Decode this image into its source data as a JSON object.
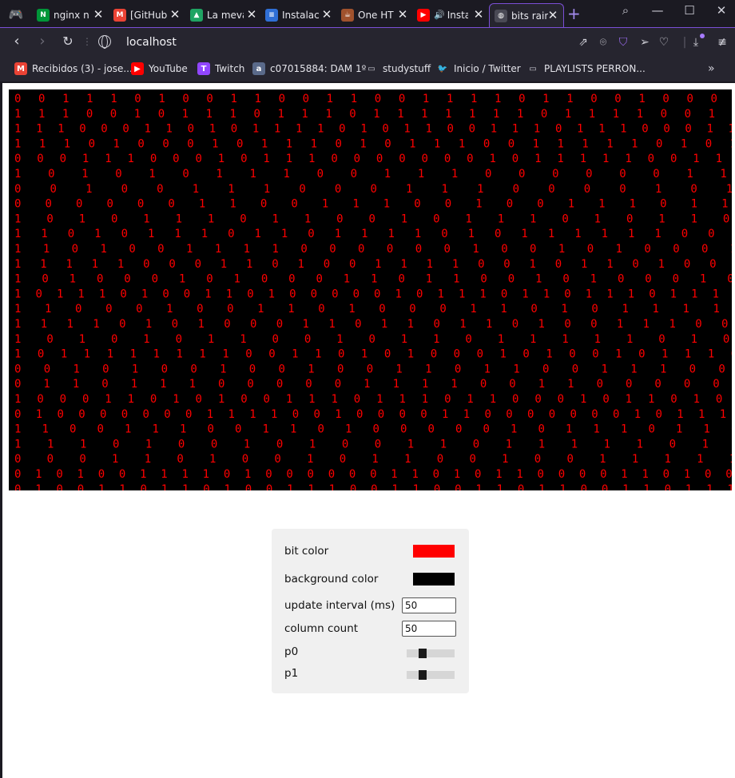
{
  "tabs": [
    {
      "title": "nginx n",
      "icon": "nginx-icon",
      "color": "#009639",
      "glyph": "N"
    },
    {
      "title": "[GitHub",
      "icon": "gmail-icon",
      "color": "#ea4335",
      "glyph": "M"
    },
    {
      "title": "La meva",
      "icon": "google-drive-icon",
      "color": "#1fa463",
      "glyph": "▲"
    },
    {
      "title": "Instalac",
      "icon": "contact-card-icon",
      "color": "#2f6fd6",
      "glyph": "≡"
    },
    {
      "title": "One HT",
      "icon": "coffee-icon",
      "color": "#a0522d",
      "glyph": "☕"
    },
    {
      "title": "Insta",
      "icon": "youtube-icon",
      "color": "#ff0000",
      "glyph": "▶"
    },
    {
      "title": "bits rain",
      "icon": "globe-icon",
      "color": "#4a4a55",
      "glyph": "◍"
    }
  ],
  "address": {
    "url": "localhost"
  },
  "bookmarks": [
    {
      "label": "Recibidos (3) - jose...",
      "icon": "gmail-icon",
      "color": "#ea4335",
      "glyph": "M"
    },
    {
      "label": "YouTube",
      "icon": "youtube-icon",
      "color": "#ff0000",
      "glyph": "▶"
    },
    {
      "label": "Twitch",
      "icon": "twitch-icon",
      "color": "#9146ff",
      "glyph": "T"
    },
    {
      "label": "c07015884: DAM 1º",
      "icon": "school-icon",
      "color": "#5a6a8a",
      "glyph": "a"
    },
    {
      "label": "studystuff",
      "icon": "folder-icon",
      "color": "transparent",
      "glyph": "▭"
    },
    {
      "label": "Inicio / Twitter",
      "icon": "twitter-icon",
      "color": "transparent",
      "glyph": "🐦"
    },
    {
      "label": "PLAYLISTS PERRON...",
      "icon": "folder-icon",
      "color": "transparent",
      "glyph": "▭"
    }
  ],
  "rain": {
    "bit_color": "#ff0000",
    "background_color": "#000000",
    "rows": [
      "  0 0      1 1      1 0      1 0      0 1 1   0 0 1 1 0    0    1 1 1 1    0    1 1 0    0      1    0    0 0 1",
      "  1 1    1      0 0 1 0      1 1 1    0      1      1      1 0 1 1 1    1 1 1 1 0    1    1    1    1 0 0 1",
      "1    1 1 0    0 0        1    1 0 1 0 1 1 1    1          0 1 0 1 1 0 0    1    1 1 0 1    1 1 0    0 0 1    1",
      "1    1      1 0 1    0 0 0 1    0 1    1 1 0 1 0      1 1 1          0 0 1    1 1 1          1        0    1 0 1 0",
      "  0 0 0    1 1    1 0 0 0    1    0 1    1              1          0 0 0 0 0 0 0 1    0 1 1 1    1 1 0 0 1 1",
      "  1 0    1        0 1        0 1          1        1 0    0        1    1 1 0        0    0 0 0        0 1        1 1 1",
      "    0 0        1 0    0 1    1    1      0 0          0    1 1 1 0    0 0        0        1        0            1        0 1 1",
      "0    0 0 0 0 0 1 1 0 0          1 1 1              0 0 1 0                  0    1 1    1 0        1 1 0                1 0",
      "  1              0    1    0 1 1 1    0    1 1          0    0 1                0 1    1 1    0 1 0        1    1 0 1 1",
      "    1 1          0 1    0 1 1    1 0 1 1 0 1      1    1      1    0 1          0 1    1 1    1 1    1 0 0    0",
      "    1 1 0        1 0    0 1 1    1 1 0    0    0 0 0 0 1          0            0 1 0        1 0 0 0            1    0 0",
      "    1    1    1 1    1          0 0 0 1        1    0    1 0 0 1 1 1          1    0 0    1 0    1 1 0 1 0 0    1 1",
      "              1      0    1 0 0 0 1    0          1 0 0    0    1 1 0    1    1    0 0 1 0 1    0        0 0 1 0 1",
      "1    0        1 1 1 0 1 0 0 1 1 0 1 0 0 0 0 0        1 0 1        1 1 0 1 1 0    1 1 1    0 1    1        1    1 1",
      "      1    1 0 0    0          1 0    0 1 1 0 1 0 0 0    1        1 0          1 0 1 1        1 1          1        0",
      "1    1 1 1 0    1 0    1    0        0    0 1    1 0    1                1    0 1 1    0    1 0 0 1 1 1    0 0    0 1",
      "  1        0 1              0 1        0 1 1        0    0 1    0 1 1        0 1 1 1 1 1 0 1    0            1        1",
      "  1 0 1        1        1 1 1 1 1 1 0 0 1 1 0    1 0 1        0 0 0          1 0 1 0 0 1 0    1 1    1 0            0 0 0",
      "      0 0 1              0 1 0 0    1    0 0 1    0        0    1 1    0 1 1        0          0        1    1 1 0 0 0 1 0",
      "0 1 1 0    1    1    1 0    0    0 0      0 1    1    1    1 0 0    1    1        0    0    0 0        0            1 0 1",
      "  1 0 0 0 1 1    0 1 0 1 0 0 1 1          1 0 1 1 1    0 1 1    0 0            0 1 0 1 1 0    1        0 0        0",
      "0 1 0    0 0        0 0 0        0 1 1 1 1 0    0 1 0 0 0 0 1 1    0 0            0 0 0    0 0 1    0 1 1 1    1",
      "    1    1 0 0 1 1 1 0 0          1    1    0    1 0 0          0 0            0 1 0    1 1 1        0          1 1 0 0 1 0",
      "  1        1 1    0              1 0    0 1        0            1 0    0    1 1 0 1 1 1    1 1 0 1        1        0    1",
      "0 0 0    1    1 0          1 0 0 1          0 1    1    0    0 1    0 0                1    1 1              1    1        0 0 0 0",
      "0            1 0 1 0 0 1 1 1 1 0 1          0    0 0 0 0 0 1 1 0 1    0 1          1 0 0 0 0 1 1 0 1 0 0      0    1",
      "  0 1 0 0    1 1    0 1    1 0 1    0 0 1 1      1    0    0 1    1 0 0 1      1 0 1    1 0 0 1 1    0 1    1 1 0"
    ]
  },
  "controls": {
    "bit_color_label": "bit color",
    "bit_color": "#ff0000",
    "background_color_label": "background color",
    "background_color": "#000000",
    "update_interval_label": "update interval (ms)",
    "update_interval": "50",
    "column_count_label": "column count",
    "column_count": "50",
    "p0_label": "p0",
    "p0_value": 0.3,
    "p1_label": "p1",
    "p1_value": 0.3
  }
}
